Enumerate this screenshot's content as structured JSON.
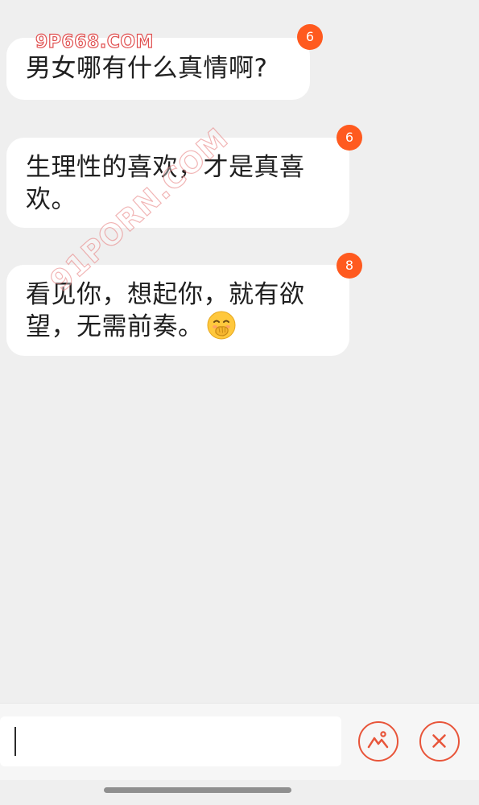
{
  "watermarks": {
    "top": "9P668.COM",
    "diagonal": "91PORN.COM"
  },
  "messages": [
    {
      "lines": [
        "男女哪有什么真情啊?"
      ],
      "badge": "6"
    },
    {
      "lines": [
        "生理性的喜欢，才是真喜",
        "欢。"
      ],
      "badge": "6"
    },
    {
      "lines": [
        "看见你，想起你，就有欲",
        "望，无需前奏。"
      ],
      "badge": "8",
      "emoji_icon": "face-with-hand-over-mouth-icon"
    }
  ],
  "input": {
    "value": ""
  },
  "actions": {
    "image_icon": "mountain-image-icon",
    "close_icon": "close-x-icon"
  },
  "colors": {
    "accent": "#e8553a",
    "badge": "#ff5a1f",
    "background": "#efefef",
    "bubble": "#ffffff"
  }
}
